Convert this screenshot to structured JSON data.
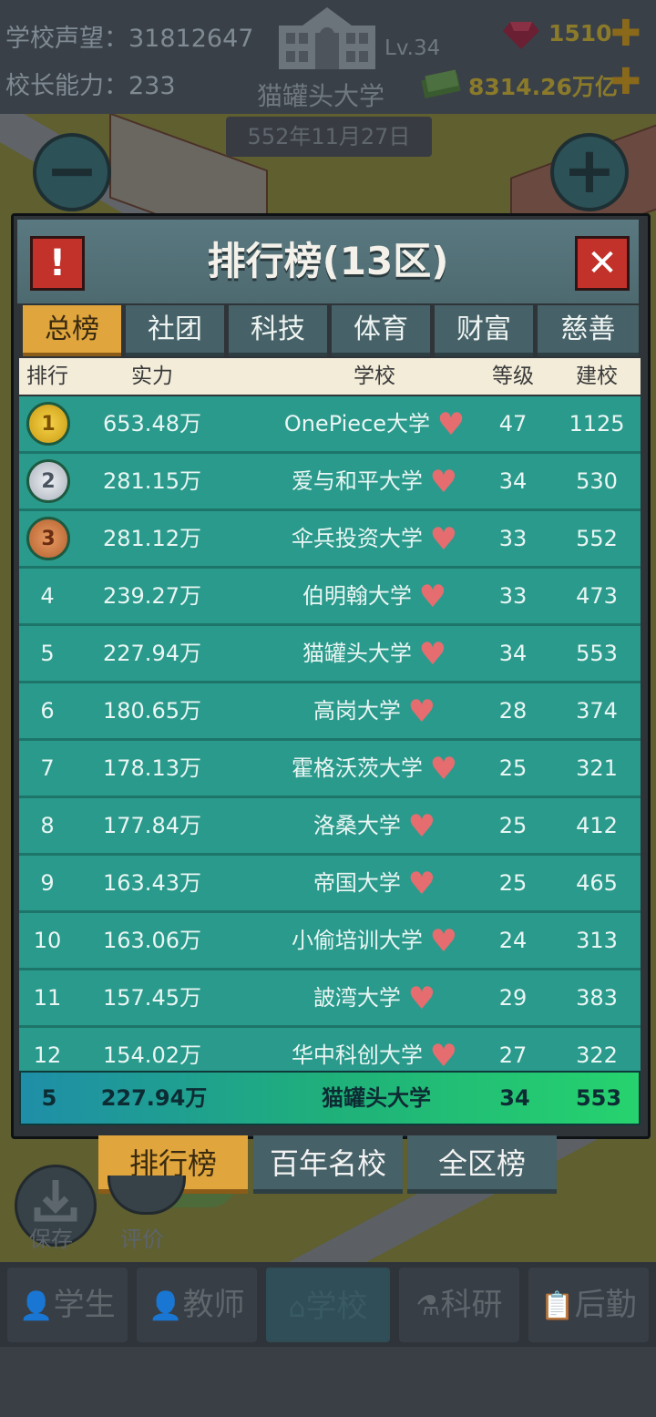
{
  "top": {
    "reputation_label": "学校声望：",
    "reputation_value": "31812647",
    "ability_label": "校长能力：",
    "ability_value": "233",
    "school_name": "猫罐头大学",
    "level": "Lv.34",
    "gems": "1510",
    "money": "8314.26万亿",
    "date": "552年11月27日"
  },
  "dialog": {
    "title": "排行榜(13区)",
    "tabs": [
      "总榜",
      "社团",
      "科技",
      "体育",
      "财富",
      "慈善"
    ],
    "active_tab": 0,
    "columns": [
      "排行",
      "实力",
      "学校",
      "等级",
      "建校"
    ],
    "rows": [
      {
        "rank": "1",
        "power": "653.48万",
        "school": "OnePiece大学",
        "level": "47",
        "founded": "1125"
      },
      {
        "rank": "2",
        "power": "281.15万",
        "school": "爱与和平大学",
        "level": "34",
        "founded": "530"
      },
      {
        "rank": "3",
        "power": "281.12万",
        "school": "伞兵投资大学",
        "level": "33",
        "founded": "552"
      },
      {
        "rank": "4",
        "power": "239.27万",
        "school": "伯明翰大学",
        "level": "33",
        "founded": "473"
      },
      {
        "rank": "5",
        "power": "227.94万",
        "school": "猫罐头大学",
        "level": "34",
        "founded": "553"
      },
      {
        "rank": "6",
        "power": "180.65万",
        "school": "高岗大学",
        "level": "28",
        "founded": "374"
      },
      {
        "rank": "7",
        "power": "178.13万",
        "school": "霍格沃茨大学",
        "level": "25",
        "founded": "321"
      },
      {
        "rank": "8",
        "power": "177.84万",
        "school": "洛桑大学",
        "level": "25",
        "founded": "412"
      },
      {
        "rank": "9",
        "power": "163.43万",
        "school": "帝国大学",
        "level": "25",
        "founded": "465"
      },
      {
        "rank": "10",
        "power": "163.06万",
        "school": "小偷培训大学",
        "level": "24",
        "founded": "313"
      },
      {
        "rank": "11",
        "power": "157.45万",
        "school": "詖湾大学",
        "level": "29",
        "founded": "383"
      },
      {
        "rank": "12",
        "power": "154.02万",
        "school": "华中科创大学",
        "level": "27",
        "founded": "322"
      }
    ],
    "self_row": {
      "rank": "5",
      "power": "227.94万",
      "school": "猫罐头大学",
      "level": "34",
      "founded": "553"
    }
  },
  "bottom_tabs": [
    "排行榜",
    "百年名校",
    "全区榜"
  ],
  "side_buttons": {
    "save": "保存",
    "rate": "评价"
  },
  "nav": [
    "学生",
    "教师",
    "学校",
    "科研",
    "后勤"
  ],
  "colors": {
    "row": "#2a9a8c",
    "accent": "#e0a63d",
    "close": "#c2322b"
  }
}
